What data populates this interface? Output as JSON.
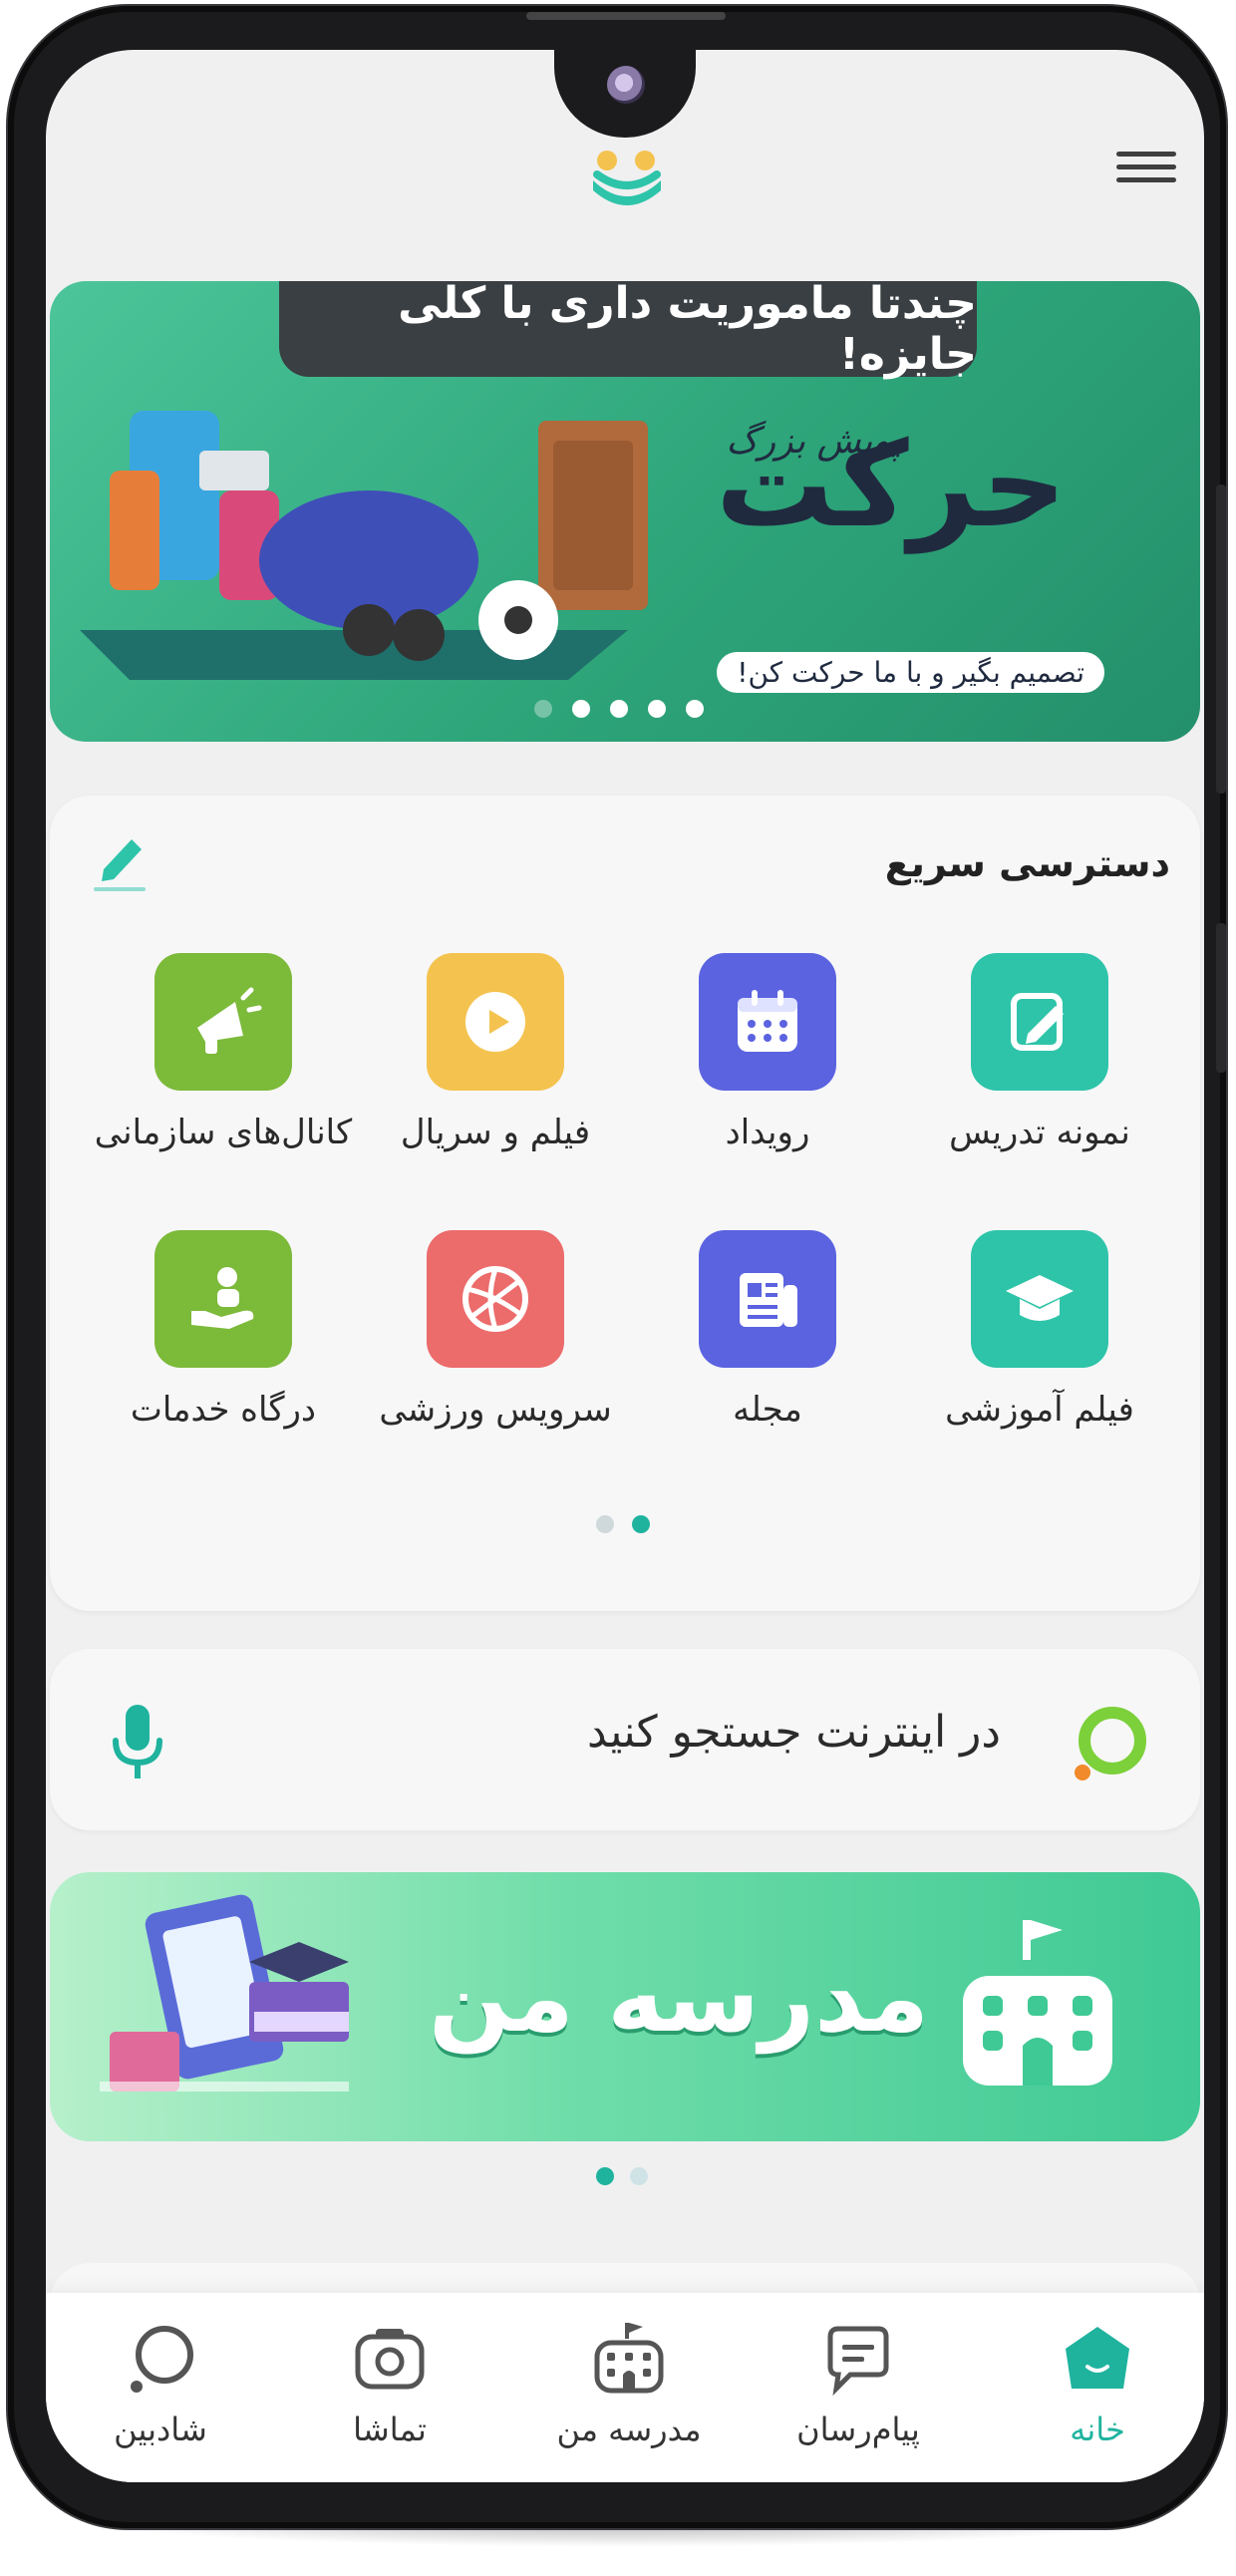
{
  "header": {
    "logo": "shad-logo",
    "menu_icon": "hamburger-icon"
  },
  "banner": {
    "ribbon_text": "چندتا ماموریت داری با کلی جایزه!",
    "title": "حرکت",
    "title_small": "پویش بزرگ",
    "tagline": "تصمیم بگیر و با ما حرکت کن!",
    "dots": 5,
    "active_dot": 0
  },
  "quick_access": {
    "title": "دسترسی سریع",
    "edit_icon": "pencil-icon",
    "items": [
      {
        "label": "نمونه تدریس",
        "icon": "notebook-edit-icon",
        "color": "#2ec4a9"
      },
      {
        "label": "رویداد",
        "icon": "calendar-icon",
        "color": "#5b63e0"
      },
      {
        "label": "فیلم و سریال",
        "icon": "play-icon",
        "color": "#f4c34f"
      },
      {
        "label": "کانال‌های سازمانی",
        "icon": "megaphone-icon",
        "color": "#7cba3a"
      },
      {
        "label": "فیلم آموزشی",
        "icon": "graduation-cap-icon",
        "color": "#2ec4a9"
      },
      {
        "label": "مجله",
        "icon": "newspaper-icon",
        "color": "#5b63e0"
      },
      {
        "label": "سرویس ورزشی",
        "icon": "volleyball-icon",
        "color": "#ec6b6b"
      },
      {
        "label": "درگاه خدمات",
        "icon": "hand-service-icon",
        "color": "#7cba3a"
      }
    ],
    "page_dots": 2,
    "active_page": 1
  },
  "search": {
    "placeholder": "در اینترنت جستجو کنید",
    "logo": "search-engine-logo",
    "mic_icon": "microphone-icon"
  },
  "school_banner": {
    "title": "مدرسه من",
    "icon": "school-building-icon",
    "dots": 2,
    "active_dot": 0
  },
  "bottom_nav": {
    "items": [
      {
        "label": "خانه",
        "icon": "home-icon",
        "active": true
      },
      {
        "label": "پیام‌رسان",
        "icon": "chat-icon",
        "active": false
      },
      {
        "label": "مدرسه من",
        "icon": "school-icon",
        "active": false
      },
      {
        "label": "تماشا",
        "icon": "camera-icon",
        "active": false
      },
      {
        "label": "شادبین",
        "icon": "shadbin-search-icon",
        "active": false
      }
    ]
  },
  "colors": {
    "accent": "#1fb39e",
    "banner_green": "#2ea57a",
    "background": "#f0f0f1"
  }
}
